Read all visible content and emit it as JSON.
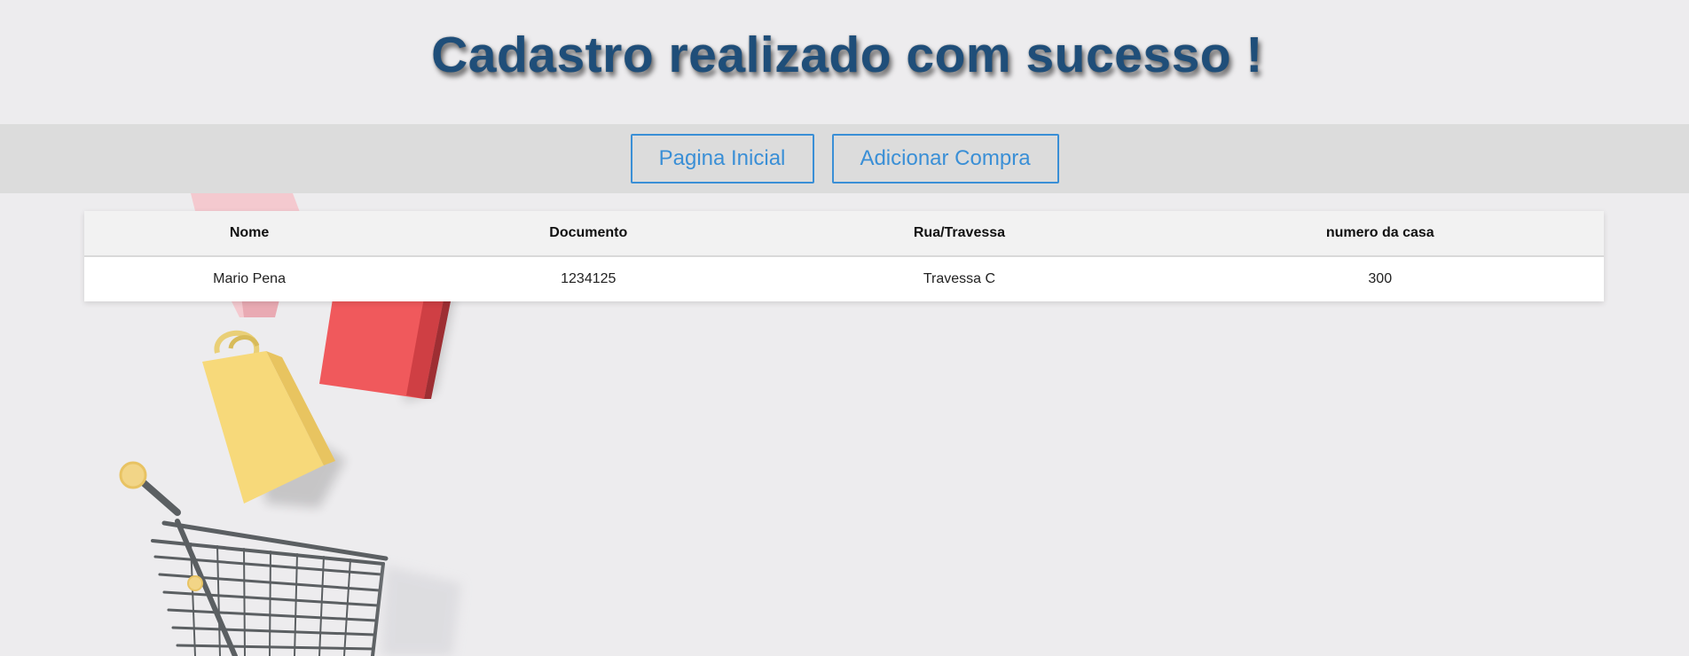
{
  "header": {
    "title": "Cadastro realizado com sucesso !"
  },
  "nav": {
    "home_label": "Pagina Inicial",
    "add_purchase_label": "Adicionar Compra"
  },
  "table": {
    "columns": [
      "Nome",
      "Documento",
      "Rua/Travessa",
      "numero da casa"
    ],
    "rows": [
      [
        "Mario Pena",
        "1234125",
        "Travessa C",
        "300"
      ]
    ]
  },
  "colors": {
    "title": "#1f4e79",
    "accent": "#3a8fd6",
    "page_background": "#edecee",
    "nav_background": "#dcdcdc"
  },
  "background_image": {
    "icons": [
      "shopping-cart-icon",
      "shopping-bag-icon"
    ]
  }
}
